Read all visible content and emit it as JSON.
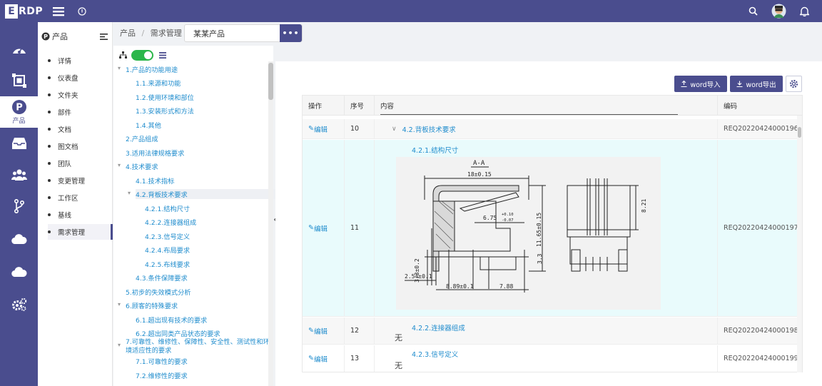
{
  "topbar": {
    "logo_box": "E",
    "logo_text": "RDP"
  },
  "leftnav": [
    {
      "icon": "dashboard-icon"
    },
    {
      "icon": "frame-icon"
    },
    {
      "icon": "product-icon",
      "label": "产品"
    },
    {
      "icon": "inbox-icon"
    },
    {
      "icon": "team-icon"
    },
    {
      "icon": "branch-icon"
    },
    {
      "icon": "cloud-icon"
    },
    {
      "icon": "cloud-icon"
    },
    {
      "icon": "settings-icon"
    }
  ],
  "subnav": {
    "title": "产品",
    "items": [
      "详情",
      "仪表盘",
      "文件夹",
      "部件",
      "文档",
      "图文档",
      "团队",
      "变更管理",
      "工作区",
      "基线",
      "需求管理"
    ],
    "active": "需求管理"
  },
  "breadcrumb": {
    "root": "产品",
    "sep": "/",
    "current": "需求管理"
  },
  "product_field": {
    "value": "某某产品",
    "more": "•••"
  },
  "tree": [
    "1.产品的功能用途",
    "1.1.来源和功能",
    "1.2.使用环境和部位",
    "1.3.安装形式和方法",
    "1.4.其他",
    "2.产品组成",
    "3.适用法律规格要求",
    "4.技术要求",
    "4.1.技术指标",
    "4.2.背板技术要求",
    "4.2.1.结构尺寸",
    "4.2.2.连接器组成",
    "4.2.3.信号定义",
    "4.2.4.布局要求",
    "4.2.5.布线要求",
    "4.3.条件保障要求",
    "5.初步的失效模式分析",
    "6.顾客的特殊要求",
    "6.1.超出现有技术的要求",
    "6.2.超出同类产品状态的要求",
    "7.可靠性、维修性、保障性、安全性、测试性和环境适应性的要求",
    "7.1.可靠性的要求",
    "7.2.维修性的要求"
  ],
  "toolbar": {
    "import": "word导入",
    "export": "word导出"
  },
  "table": {
    "headers": [
      "操作",
      "序号",
      "内容",
      "编码"
    ],
    "rows": [
      {
        "action": "编辑",
        "seq": "10",
        "content": "4.2.背板技术要求",
        "code": "REQ20220424000196"
      },
      {
        "action": "编辑",
        "seq": "11",
        "content": "4.2.1.结构尺寸",
        "code": "REQ20220424000197"
      },
      {
        "action": "编辑",
        "seq": "12",
        "content": "4.2.2.连接器组成",
        "body": "无",
        "code": "REQ20220424000198"
      },
      {
        "action": "编辑",
        "seq": "13",
        "content": "4.2.3.信号定义",
        "body": "无",
        "code": "REQ20220424000199"
      }
    ]
  },
  "drawing": {
    "section": "A-A",
    "dims": [
      "18±0.15",
      "6.75",
      "+0.10",
      "-0.07",
      "11.65±0.15",
      "8.21",
      "3.3",
      "3.3±0.2",
      "2.54±0.1",
      "8.89±0.1",
      "7.88"
    ]
  },
  "colors": {
    "brand": "#4a4d8e",
    "link": "#1f8ccd",
    "toggle": "#2bb64a",
    "highlight_row": "#e9fbfc"
  }
}
